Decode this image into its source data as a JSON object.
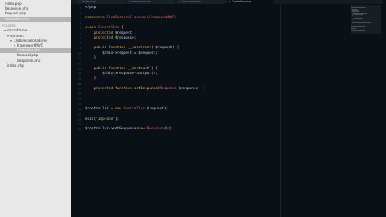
{
  "sidebar": {
    "open_files": [
      "index.php",
      "Response.php",
      "Request.php",
      "Controller.php"
    ],
    "folders_header": "FOLDERS",
    "tree": [
      {
        "label": "microframe",
        "expanded": true,
        "indent": 1
      },
      {
        "label": "vendors",
        "expanded": true,
        "indent": 2
      },
      {
        "label": "ClubDesarrolladores",
        "expanded": true,
        "indent": 3
      },
      {
        "label": "FrameworkMVC",
        "expanded": true,
        "indent": 4
      },
      {
        "label": "Controller.php",
        "indent": 5,
        "selected": true
      },
      {
        "label": "Request.php",
        "indent": 5
      },
      {
        "label": "Response.php",
        "indent": 5
      },
      {
        "label": "index.php",
        "indent": 2
      }
    ]
  },
  "tabs": [
    {
      "label": "index.php",
      "active": false
    },
    {
      "label": "Response.php",
      "active": false
    },
    {
      "label": "Response.php",
      "active": false
    },
    {
      "label": "Controller.php",
      "active": true
    }
  ],
  "code_lines": [
    [
      [
        "<?php",
        "var"
      ]
    ],
    [],
    [
      [
        "namespace ",
        "kw2"
      ],
      [
        "ClubDesarrolladores\\FrameworkMVC;",
        "cls"
      ]
    ],
    [],
    [
      [
        "class ",
        "kw2"
      ],
      [
        "Controller ",
        "cls"
      ],
      [
        "{",
        "var"
      ]
    ],
    [
      [
        "    protected ",
        "kw2"
      ],
      [
        "$request;",
        "var"
      ]
    ],
    [
      [
        "    protected ",
        "kw2"
      ],
      [
        "$response;",
        "var"
      ]
    ],
    [],
    [
      [
        "    public ",
        "kw2"
      ],
      [
        "function ",
        "kw2"
      ],
      [
        "__construct",
        "fn"
      ],
      [
        "( $request) {",
        "var"
      ]
    ],
    [
      [
        "        $this->request = $request;",
        "var"
      ]
    ],
    [
      [
        "    }",
        "var"
      ]
    ],
    [],
    [
      [
        "    public ",
        "kw2"
      ],
      [
        "function ",
        "kw2"
      ],
      [
        "__destruct",
        "fn"
      ],
      [
        "() {",
        "var"
      ]
    ],
    [
      [
        "        $this->response->output();",
        "var"
      ]
    ],
    [
      [
        "    }",
        "var"
      ]
    ],
    [],
    [
      [
        "    protected ",
        "kw2"
      ],
      [
        "function ",
        "kw2"
      ],
      [
        "setResponse",
        "fn"
      ],
      [
        "(",
        "var"
      ],
      [
        "Response ",
        "cls"
      ],
      [
        "$response) {",
        "var"
      ]
    ],
    [],
    [],
    [],
    [
      [
        "$controller = ",
        "var"
      ],
      [
        "new ",
        "kw2"
      ],
      [
        "Controller",
        "cls"
      ],
      [
        "($request);",
        "var"
      ]
    ],
    [],
    [
      [
        "exit(",
        "var"
      ],
      [
        "'ImpFace'",
        "str"
      ],
      [
        ");",
        "var"
      ]
    ],
    [],
    [
      [
        "$controller->setResponse(",
        "var"
      ],
      [
        "new ",
        "kw2"
      ],
      [
        "Response",
        "cls"
      ],
      [
        "());",
        "var"
      ]
    ]
  ],
  "line_numbers": [
    "1",
    "2",
    "3",
    "4",
    "5",
    "6",
    "7",
    "8",
    "9",
    "10",
    "11",
    "12",
    "13",
    "14",
    "15",
    "16",
    "17",
    "18",
    "19",
    "20",
    "21",
    "22",
    "23",
    "24",
    "25"
  ],
  "current_line": 16
}
